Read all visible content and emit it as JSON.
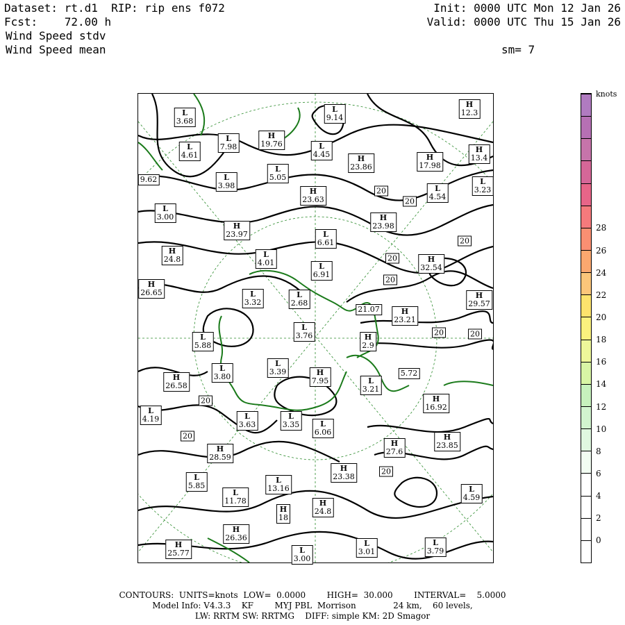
{
  "header": {
    "dataset": "Dataset: rt.d1  RIP: rip ens f072",
    "fcst": "Fcst:    72.00 h",
    "field1": "Wind Speed stdv",
    "field2": "Wind Speed mean",
    "init": "Init: 0000 UTC Mon 12 Jan 26",
    "valid": "Valid: 0000 UTC Thu 15 Jan 26",
    "sm": "sm= 7"
  },
  "colorbar": {
    "units": "knots",
    "labels": [
      "0",
      "2",
      "4",
      "6",
      "8",
      "10",
      "12",
      "14",
      "16",
      "18",
      "20",
      "22",
      "24",
      "26",
      "28"
    ],
    "colors": [
      "#ffffff",
      "#ffffff",
      "#ffffff",
      "#ffffff",
      "#f2fdf2",
      "#e0f8e0",
      "#d2f4cf",
      "#c7f1bd",
      "#d9f5a5",
      "#eef79a",
      "#fbf17e",
      "#fde36d",
      "#fcc67a",
      "#fba86f",
      "#fa8f72",
      "#f57a7c",
      "#e76588",
      "#d56798",
      "#c674aa",
      "#b670b4",
      "#b07bc0"
    ]
  },
  "highs_lows": [
    {
      "t": "L",
      "v": "3.68"
    },
    {
      "t": "L",
      "v": "7.98"
    },
    {
      "t": "H",
      "v": "19.76"
    },
    {
      "t": "L",
      "v": "9.14"
    },
    {
      "t": "H",
      "v": "12.3"
    },
    {
      "t": "L",
      "v": "4.61"
    },
    {
      "t": "L",
      "v": "4.45"
    },
    {
      "t": "H",
      "v": "13.4"
    },
    {
      "t": "H",
      "v": "23.86"
    },
    {
      "t": "H",
      "v": "17.98"
    },
    {
      "t": "",
      "v": "9.62"
    },
    {
      "t": "L",
      "v": "3.98"
    },
    {
      "t": "L",
      "v": "5.05"
    },
    {
      "t": "L",
      "v": "4.54"
    },
    {
      "t": "L",
      "v": "3.23"
    },
    {
      "t": "H",
      "v": "23.63"
    },
    {
      "t": "L",
      "v": "3.00"
    },
    {
      "t": "H",
      "v": "23.98"
    },
    {
      "t": "H",
      "v": "23.97"
    },
    {
      "t": "L",
      "v": "6.61"
    },
    {
      "t": "H",
      "v": "24.8"
    },
    {
      "t": "L",
      "v": "4.01"
    },
    {
      "t": "L",
      "v": "6.91"
    },
    {
      "t": "H",
      "v": "32.54"
    },
    {
      "t": "H",
      "v": "26.65"
    },
    {
      "t": "L",
      "v": "3.32"
    },
    {
      "t": "L",
      "v": "2.68"
    },
    {
      "t": "",
      "v": "21.07"
    },
    {
      "t": "H",
      "v": "23.21"
    },
    {
      "t": "H",
      "v": "29.57"
    },
    {
      "t": "L",
      "v": "3.76"
    },
    {
      "t": "L",
      "v": "5.88"
    },
    {
      "t": "H",
      "v": "2.9"
    },
    {
      "t": "L",
      "v": "3.39"
    },
    {
      "t": "L",
      "v": "3.80"
    },
    {
      "t": "H",
      "v": "7.95"
    },
    {
      "t": "",
      "v": "5.72"
    },
    {
      "t": "L",
      "v": "3.21"
    },
    {
      "t": "H",
      "v": "26.58"
    },
    {
      "t": "H",
      "v": "16.92"
    },
    {
      "t": "L",
      "v": "4.19"
    },
    {
      "t": "L",
      "v": "3.63"
    },
    {
      "t": "L",
      "v": "3.35"
    },
    {
      "t": "L",
      "v": "6.06"
    },
    {
      "t": "H",
      "v": "27.6"
    },
    {
      "t": "H",
      "v": "23.85"
    },
    {
      "t": "H",
      "v": "28.59"
    },
    {
      "t": "H",
      "v": "23.38"
    },
    {
      "t": "L",
      "v": "5.85"
    },
    {
      "t": "L",
      "v": "13.16"
    },
    {
      "t": "L",
      "v": "11.78"
    },
    {
      "t": "L",
      "v": "4.59"
    },
    {
      "t": "H",
      "v": "24.8"
    },
    {
      "t": "H",
      "v": "18"
    },
    {
      "t": "H",
      "v": "26.36"
    },
    {
      "t": "H",
      "v": "25.77"
    },
    {
      "t": "L",
      "v": "3.01"
    },
    {
      "t": "L",
      "v": "3.79"
    },
    {
      "t": "L",
      "v": "3.00"
    }
  ],
  "contour_label": "20",
  "footer": {
    "line1": "CONTOURS:  UNITS=knots  LOW=  0.0000        HIGH=  30.000        INTERVAL=    5.0000",
    "line2": "Model Info: V4.3.3    KF        MYJ PBL  Morrison              24 km,    60 levels,",
    "line3": "LW: RRTM SW: RRTMG    DIFF: simple KM: 2D Smagor"
  }
}
